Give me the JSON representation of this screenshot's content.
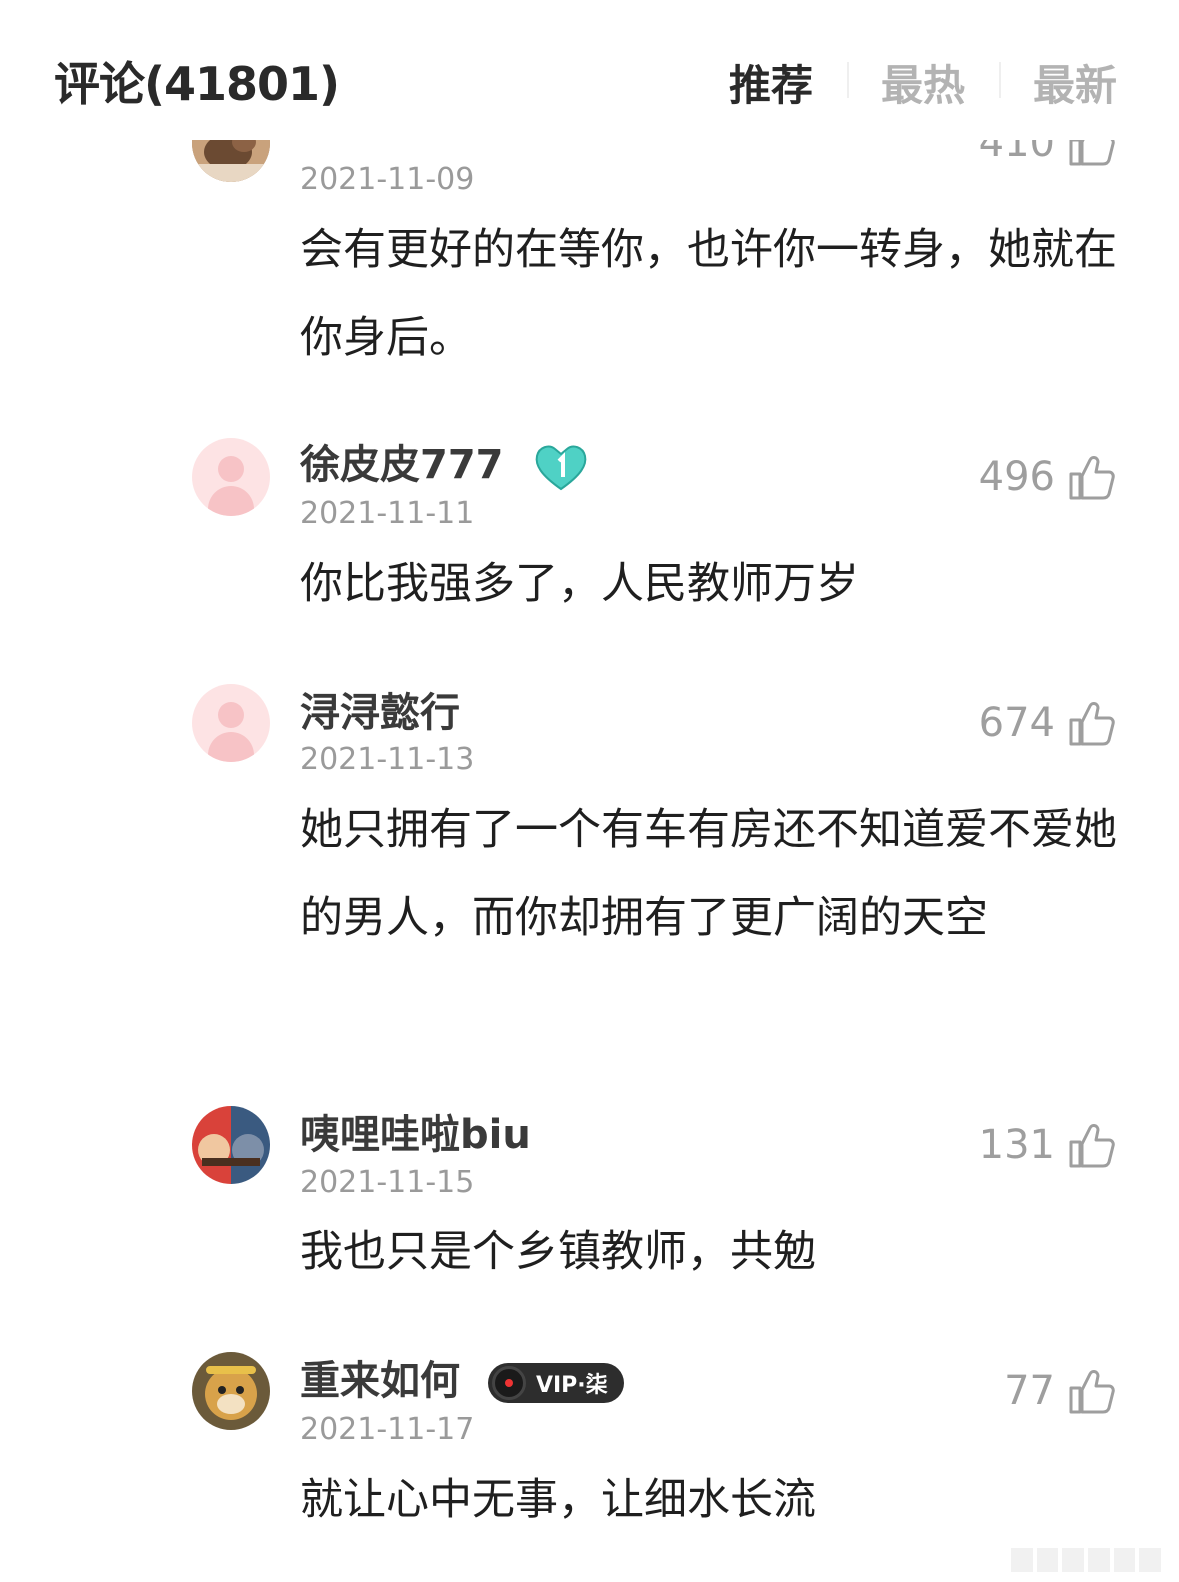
{
  "header": {
    "title": "评论(41801)",
    "tabs": [
      "推荐",
      "最热",
      "最新"
    ],
    "active_tab": "推荐"
  },
  "comments": [
    {
      "name": "",
      "date": "2021-11-09",
      "likes": "410",
      "text": "会有更好的在等你，也许你一转身，她就在你身后。",
      "avatar": "photo-cat"
    },
    {
      "name": "徐皮皮777",
      "date": "2021-11-11",
      "likes": "496",
      "text": "你比我强多了，人民教师万岁",
      "avatar": "default",
      "badge": "heart-badge"
    },
    {
      "name": "浔浔懿行",
      "date": "2021-11-13",
      "likes": "674",
      "text": "她只拥有了一个有车有房还不知道爱不爱她的男人，而你却拥有了更广阔的天空",
      "avatar": "default"
    },
    {
      "name": "咦哩哇啦biu",
      "date": "2021-11-15",
      "likes": "131",
      "text": "我也只是个乡镇教师，共勉",
      "avatar": "photo-mario"
    },
    {
      "name": "重来如何",
      "date": "2021-11-17",
      "likes": "77",
      "text": "就让心中无事，让细水长流",
      "avatar": "photo-monkey",
      "vip_label": "VIP·柒"
    }
  ],
  "colors": {
    "text_primary": "#1f1f1f",
    "name": "#3a3a3a",
    "muted": "#9a9a9a",
    "tab_inactive": "#b3b3b3",
    "default_avatar": "#fde3e4",
    "badge": "#4fd1c5"
  }
}
